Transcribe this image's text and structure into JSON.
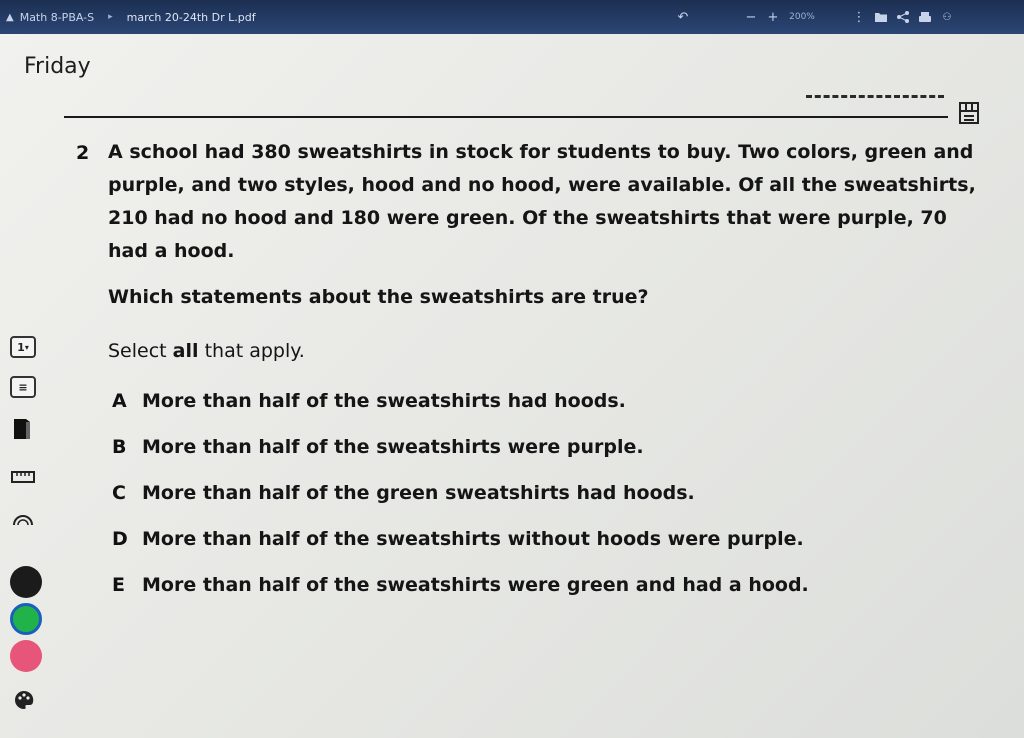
{
  "topbar": {
    "breadcrumb": "Math 8-PBA-S",
    "file_name": "march 20-24th Dr L.pdf",
    "zoom_level": "200%"
  },
  "document": {
    "day_heading": "Friday",
    "question_number": "2",
    "stem": "A school had 380 sweatshirts in stock for students to buy. Two colors, green and purple, and two styles, hood and no hood, were available. Of all the sweatshirts, 210 had no hood and 180 were green. Of the sweatshirts that were purple, 70 had a hood.",
    "prompt": "Which statements about the sweatshirts are true?",
    "select_prefix": "Select",
    "select_strong": "all",
    "select_suffix": "that apply.",
    "options": [
      {
        "letter": "A",
        "text": "More than half of the sweatshirts had hoods."
      },
      {
        "letter": "B",
        "text": "More than half of the sweatshirts were purple."
      },
      {
        "letter": "C",
        "text": "More than half of the green sweatshirts had hoods."
      },
      {
        "letter": "D",
        "text": "More than half of the sweatshirts without hoods were purple."
      },
      {
        "letter": "E",
        "text": "More than half of the sweatshirts were green and had a hood."
      }
    ]
  },
  "sidebar": {
    "page_selector": "1",
    "pen_colors": [
      "#1b1b1b",
      "#21b34a",
      "#e8557a"
    ]
  },
  "icons": {
    "home": "home-icon",
    "undo": "undo-icon",
    "zoom_out": "minus-icon",
    "zoom_in": "plus-icon",
    "more": "more-icon",
    "folder": "folder-icon",
    "share": "share-icon",
    "print": "print-icon",
    "tools": "tools-icon",
    "menu": "menu-icon",
    "highlighter": "highlighter-icon",
    "ruler": "ruler-icon",
    "protractor": "protractor-icon",
    "palette": "palette-icon"
  }
}
